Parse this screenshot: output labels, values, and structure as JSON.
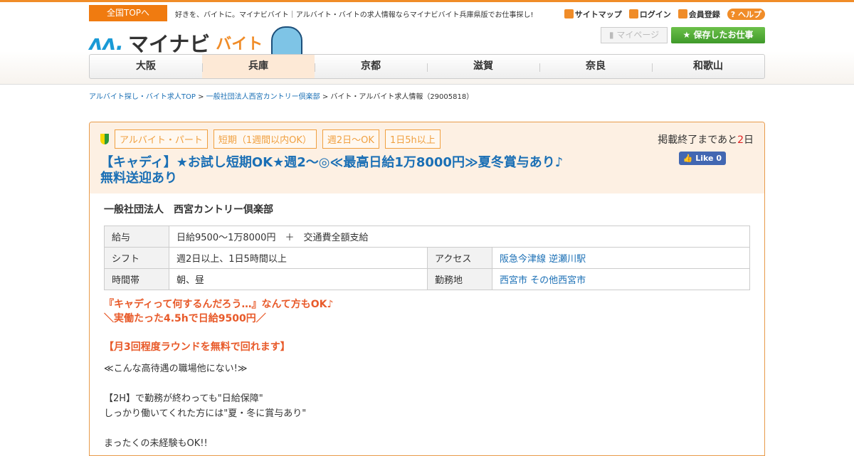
{
  "header": {
    "top_link": "全国TOPへ",
    "tagline": "好きを、バイトに。マイナビバイト｜アルバイト・バイトの求人情報ならマイナビバイト兵庫県版でお仕事探し!",
    "util": [
      "サイトマップ",
      "ログイン",
      "会員登録"
    ],
    "help": "ヘルプ",
    "logo_main": "マイナビ",
    "logo_sub": "バイト",
    "mypage": "マイページ",
    "saved": "保存したお仕事"
  },
  "nav": [
    "大阪",
    "兵庫",
    "京都",
    "滋賀",
    "奈良",
    "和歌山"
  ],
  "nav_active": "兵庫",
  "breadcrumb": {
    "home": "アルバイト探し・バイト求人TOP",
    "company": "一般社団法人西宮カントリー倶楽部",
    "current": "バイト・アルバイト求人情報（29005818）"
  },
  "job": {
    "tags": [
      "アルバイト・パート",
      "短期（1週間以内OK）",
      "週2日～OK",
      "1日5h以上"
    ],
    "title": "【キャディ】★お試し短期OK★週2～◎≪最高日給1万8000円≫夏冬賞与あり♪無料送迎あり",
    "remain_prefix": "掲載終了まであと",
    "remain_days": "2",
    "remain_suffix": "日",
    "like": "Like 0",
    "company": "一般社団法人　西宮カントリー倶楽部",
    "table": {
      "pay_label": "給与",
      "pay": "日給9500～1万8000円　＋　交通費全額支給",
      "shift_label": "シフト",
      "shift": "週2日以上、1日5時間以上",
      "access_label": "アクセス",
      "access": "阪急今津線 逆瀬川駅",
      "time_label": "時間帯",
      "time": "朝、昼",
      "location_label": "勤務地",
      "location": "西宮市 その他西宮市"
    },
    "highlight1": "『キャディって何するんだろう…』なんて方もOK♪",
    "highlight2": "＼実働たった4.5hで日給9500円／",
    "highlight3": "【月3回程度ラウンドを無料で回れます】",
    "desc": [
      "≪こんな高待遇の職場他にない!≫",
      "",
      "【2H】で勤務が終わっても\"日給保障\"",
      "しっかり働いてくれた方には\"夏・冬に賞与あり\"",
      "",
      "まったくの未経験もOK!!"
    ]
  },
  "colors": {
    "accent": "#f08c28",
    "link": "#1a6fb5",
    "highlight": "#e85a2a",
    "saved_button": "#4fa836"
  }
}
